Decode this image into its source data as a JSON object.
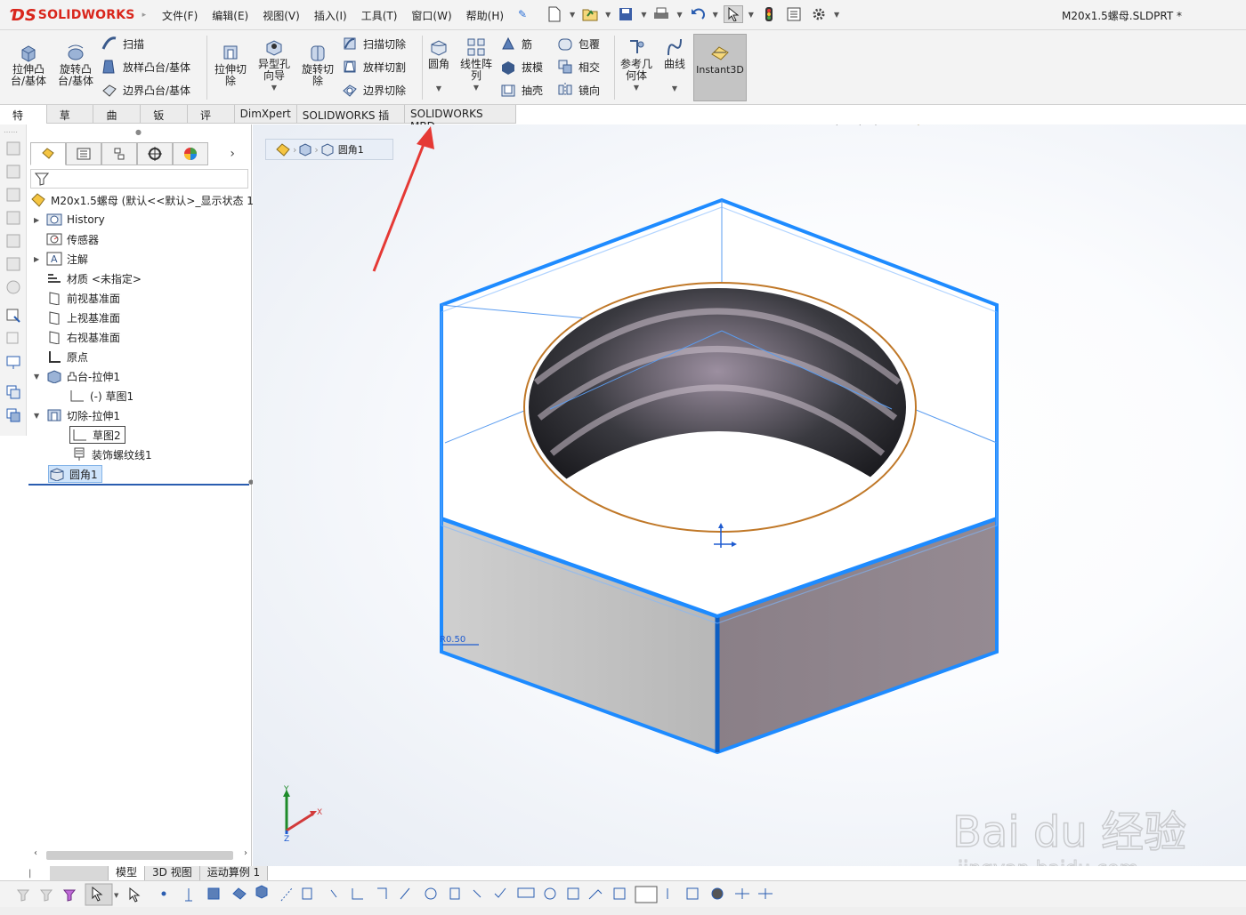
{
  "app": {
    "brand": "SOLIDWORKS",
    "brand_color": "#d9261c"
  },
  "menus": [
    "文件(F)",
    "编辑(E)",
    "视图(V)",
    "插入(I)",
    "工具(T)",
    "窗口(W)",
    "帮助(H)"
  ],
  "document_title": "M20x1.5螺母.SLDPRT *",
  "ribbon": {
    "extrude_boss": "拉伸凸\n台/基体",
    "revolve_boss": "旋转凸\n台/基体",
    "sweep": "扫描",
    "loft_boss": "放样凸台/基体",
    "boundary_boss": "边界凸台/基体",
    "extrude_cut": "拉伸切\n除",
    "hole_wizard": "异型孔\n向导",
    "revolve_cut": "旋转切\n除",
    "sweep_cut": "扫描切除",
    "loft_cut": "放样切割",
    "boundary_cut": "边界切除",
    "fillet": "圆角",
    "linear_pattern": "线性阵\n列",
    "rib": "筋",
    "draft": "拔模",
    "shell": "抽壳",
    "wrap": "包覆",
    "intersect": "相交",
    "mirror": "镜向",
    "ref_geometry": "参考几\n何体",
    "curves": "曲线",
    "instant3d": "Instant3D"
  },
  "tabs": [
    "特征",
    "草图",
    "曲面",
    "钣金",
    "评估",
    "DimXpert",
    "SOLIDWORKS 插件",
    "SOLIDWORKS MBD"
  ],
  "feature_tree": {
    "root": "M20x1.5螺母  (默认<<默认>_显示状态 1",
    "items": [
      {
        "label": "History"
      },
      {
        "label": "传感器"
      },
      {
        "label": "注解"
      },
      {
        "label": "材质 <未指定>"
      },
      {
        "label": "前视基准面"
      },
      {
        "label": "上视基准面"
      },
      {
        "label": "右视基准面"
      },
      {
        "label": "原点"
      },
      {
        "label": "凸台-拉伸1"
      },
      {
        "label": "(-) 草图1"
      },
      {
        "label": "切除-拉伸1"
      },
      {
        "label": "草图2"
      },
      {
        "label": "装饰螺纹线1"
      },
      {
        "label": "圆角1"
      }
    ]
  },
  "breadcrumb": {
    "label": "圆角1"
  },
  "dimension": {
    "label": "R0.50"
  },
  "triad": {
    "x": "X",
    "y": "Y",
    "z": "Z"
  },
  "bottom_tabs": [
    "模型",
    "3D 视图",
    "运动算例 1"
  ],
  "watermark": {
    "text": "Bai du 经验",
    "url": "jingyan.baidu.com"
  },
  "colors": {
    "selection": "#1e8bff",
    "accent": "#e53935",
    "face_grey": "#bdbdbd",
    "face_purple": "#8d8189"
  }
}
